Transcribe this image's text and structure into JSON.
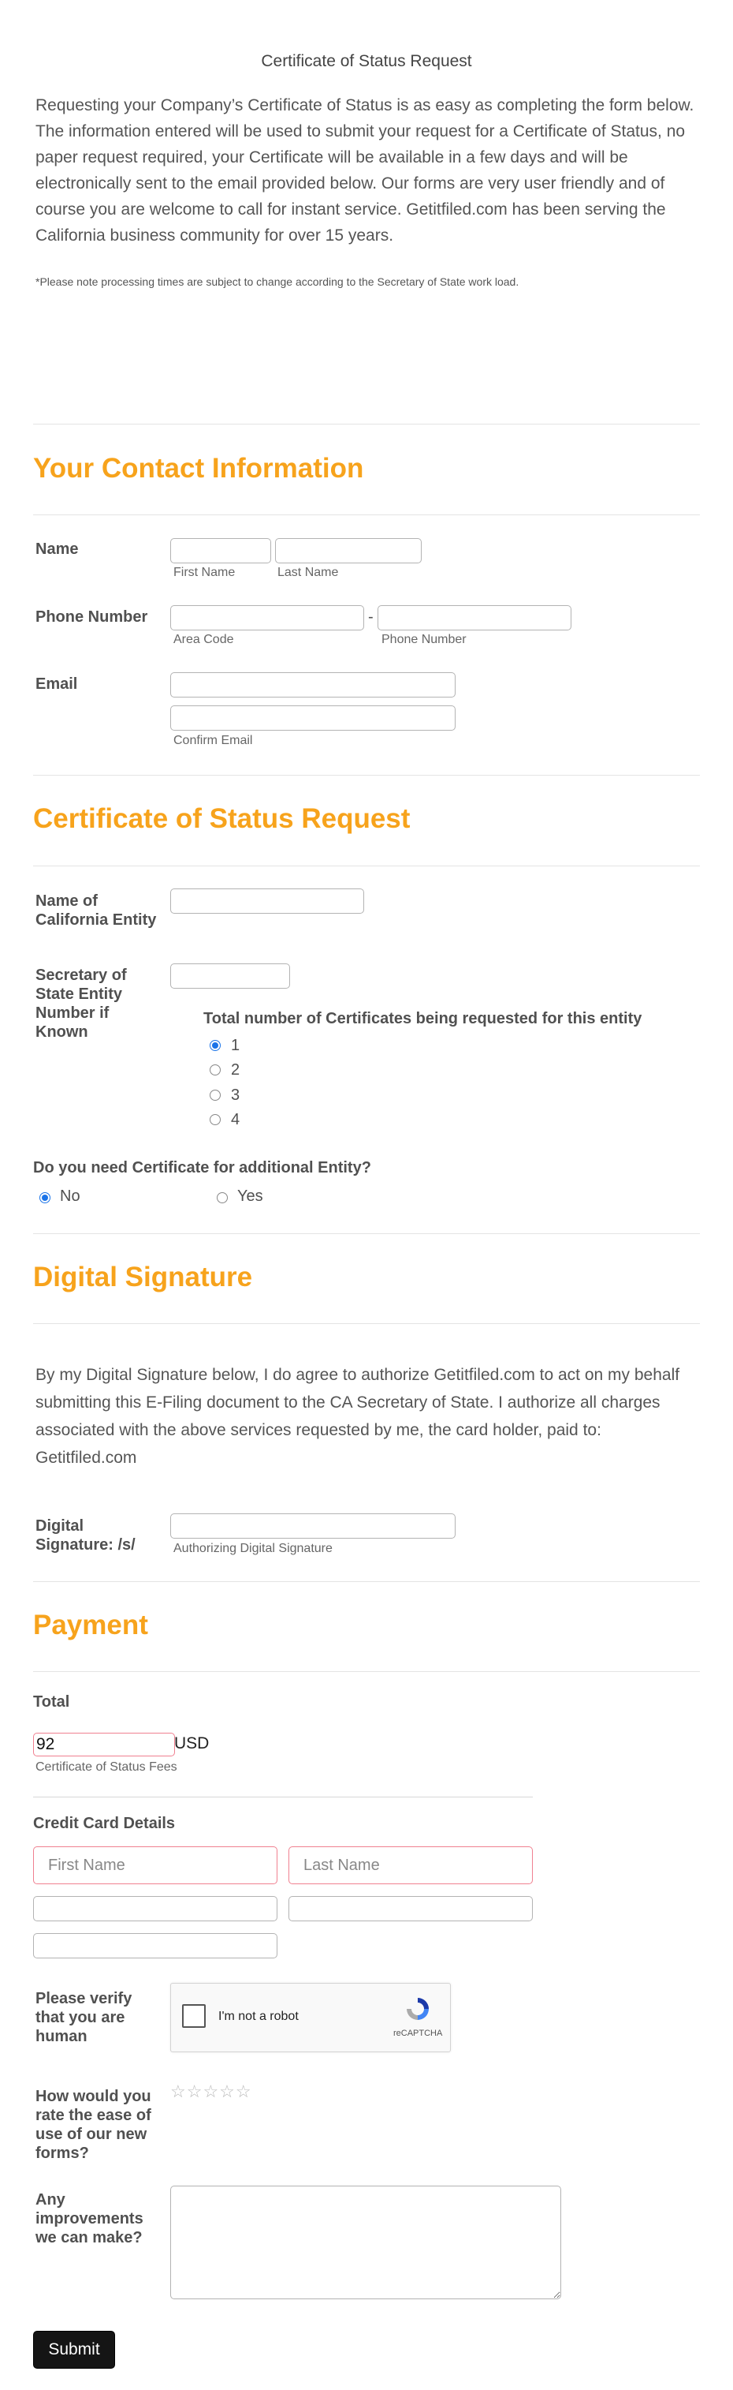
{
  "intro": {
    "title": "Certificate of Status Request",
    "text": "Requesting your Company’s Certificate of Status is as easy as completing the form below. The information entered will be used to submit your request for a Certificate of Status, no paper request required, your Certificate will be available in a few days and will be electronically sent to the email provided below. Our forms are very user friendly and of course you are welcome to call for instant service. Getitfiled.com has been serving the California business community for over 15 years.",
    "note": "*Please note processing times are subject to change according to the Secretary of State work load."
  },
  "contact": {
    "title": "Your Contact Information",
    "name_label": "Name",
    "first_name_sub": "First Name",
    "last_name_sub": "Last Name",
    "phone_label": "Phone Number",
    "phone_sep": "-",
    "area_code_sub": "Area Code",
    "phone_number_sub": "Phone Number",
    "email_label": "Email",
    "confirm_email_sub": "Confirm Email"
  },
  "request": {
    "title": "Certificate of Status Request",
    "entity_name_label": "Name of California Entity",
    "entity_number_label": "Secretary of State Entity Number if Known",
    "total_label": "Total number of Certificates being requested for this entity",
    "count_options": [
      "1",
      "2",
      "3",
      "4"
    ],
    "count_selected": "1",
    "additional_label": "Do you need Certificate for additional Entity?",
    "additional_options": [
      "No",
      "Yes"
    ],
    "additional_selected": "No"
  },
  "signature": {
    "title": "Digital Signature",
    "text": "By my Digital Signature below, I do agree to authorize Getitfiled.com to act on my behalf submitting this E-Filing document to the CA Secretary of State. I authorize all charges associated with the above services requested by me, the card holder, paid to: Getitfiled.com",
    "label": "Digital Signature: /s/",
    "sub": "Authorizing Digital Signature"
  },
  "payment": {
    "title": "Payment",
    "total_label": "Total",
    "total_value": "92",
    "currency": "USD",
    "fees_sub": "Certificate of Status Fees",
    "cc_title": "Credit Card Details",
    "first_name_placeholder": "First Name",
    "last_name_placeholder": "Last Name",
    "verify_label": "Please verify that you are human",
    "captcha_text": "I'm not a robot",
    "captcha_brand": "reCAPTCHA",
    "rating_label": "How would you rate the ease of use of our new forms?",
    "rating_stars": "☆☆☆☆☆",
    "improve_label": "Any improvements we can make?",
    "submit_label": "Submit"
  },
  "colors": {
    "accent": "#f7a31c",
    "radio": "#1a73e8",
    "error_border": "#f08090"
  }
}
